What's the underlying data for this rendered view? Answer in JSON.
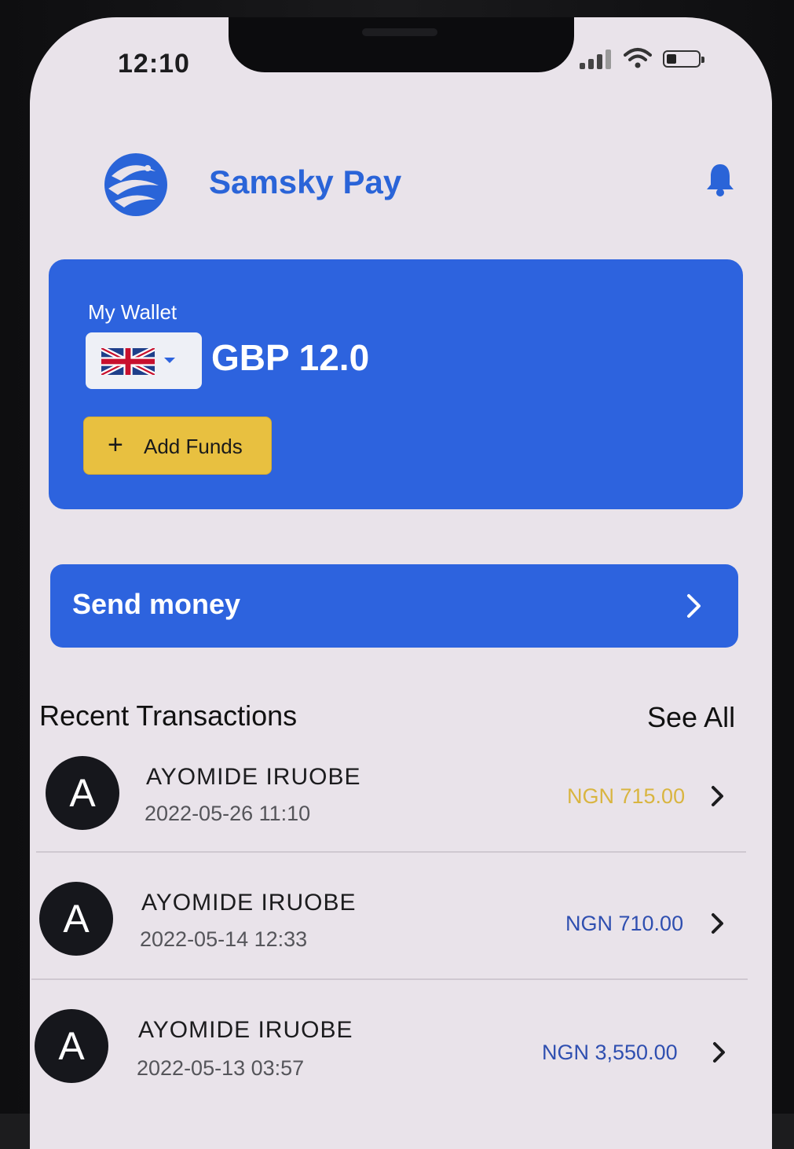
{
  "status_bar": {
    "time": "12:10"
  },
  "header": {
    "app_name": "Samsky Pay",
    "notification_icon": "bell-icon"
  },
  "wallet": {
    "label": "My Wallet",
    "currency_flag": "uk-flag-icon",
    "balance": "GBP 12.0",
    "add_funds_icon": "+",
    "add_funds_label": "Add Funds"
  },
  "send_money": {
    "label": "Send money"
  },
  "transactions": {
    "title": "Recent Transactions",
    "see_all": "See All",
    "items": [
      {
        "initial": "A",
        "name": "AYOMIDE IRUOBE",
        "date": "2022-05-26 11:10",
        "amount": "NGN 715.00",
        "amount_color": "#d9b540"
      },
      {
        "initial": "A",
        "name": "AYOMIDE IRUOBE",
        "date": "2022-05-14 12:33",
        "amount": "NGN 710.00",
        "amount_color": "#2f4fb0"
      },
      {
        "initial": "A",
        "name": "AYOMIDE IRUOBE",
        "date": "2022-05-13 03:57",
        "amount": "NGN 3,550.00",
        "amount_color": "#2f4fb0"
      }
    ]
  },
  "colors": {
    "primary": "#2d63de",
    "accent": "#e8c040",
    "background": "#e9e3ea"
  }
}
